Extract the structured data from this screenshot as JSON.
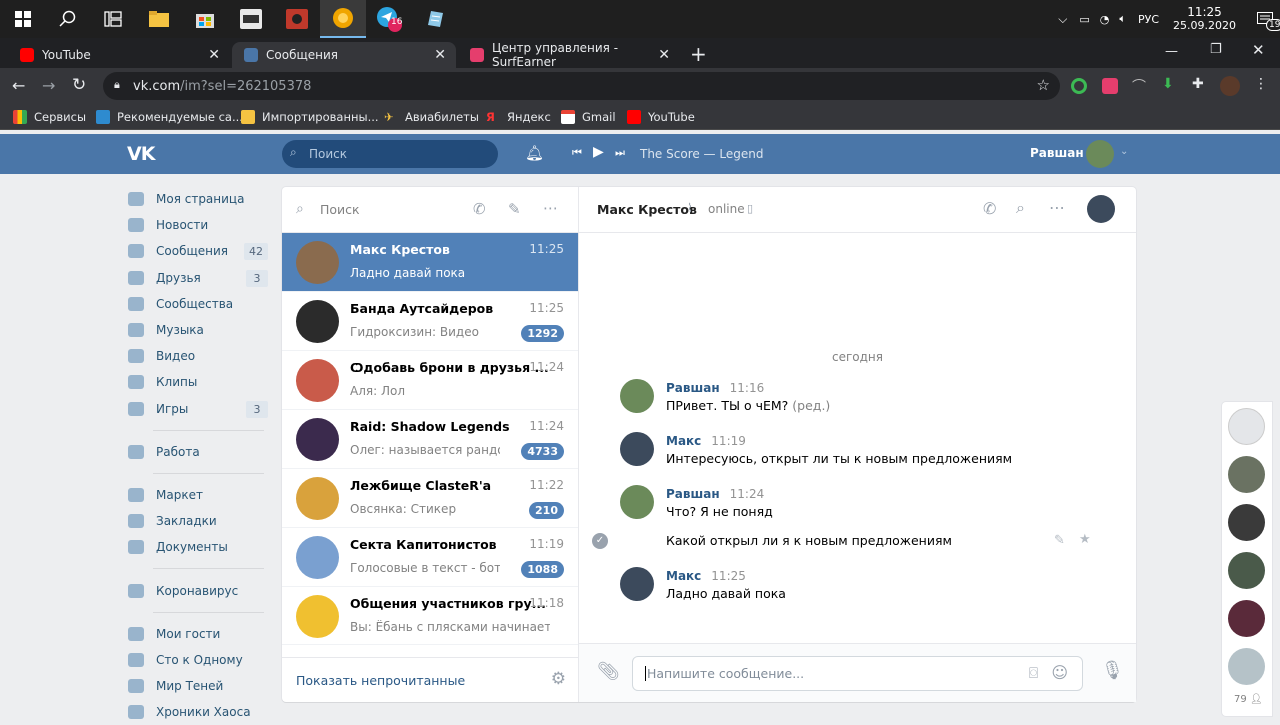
{
  "taskbar": {
    "clock_time": "11:25",
    "clock_date": "25.09.2020",
    "lang": "РУС",
    "notif_count": "19",
    "telegram_badge": "16"
  },
  "browser": {
    "tabs": [
      {
        "title": "YouTube",
        "fav_color": "#ff0000"
      },
      {
        "title": "Сообщения",
        "fav_color": "#4a76a8"
      },
      {
        "title": "Центр управления - SurfEarner",
        "fav_color": "#e53e6d"
      }
    ],
    "url_host": "vk.com",
    "url_path": "/im?sel=262105378",
    "bookmarks": [
      "Сервисы",
      "Рекомендуемые са...",
      "Импортированны...",
      "Авиабилеты",
      "Яндекс",
      "Gmail",
      "YouTube"
    ]
  },
  "vk": {
    "logo": "VK",
    "search_placeholder": "Поиск",
    "player_track": "The Score — Legend",
    "user_name": "Равшан"
  },
  "nav": {
    "items": [
      {
        "label": "Моя страница",
        "count": ""
      },
      {
        "label": "Новости",
        "count": ""
      },
      {
        "label": "Сообщения",
        "count": "42"
      },
      {
        "label": "Друзья",
        "count": "3"
      },
      {
        "label": "Сообщества",
        "count": ""
      },
      {
        "label": "Музыка",
        "count": ""
      },
      {
        "label": "Видео",
        "count": ""
      },
      {
        "label": "Клипы",
        "count": ""
      },
      {
        "label": "Игры",
        "count": "3"
      }
    ],
    "items2": [
      {
        "label": "Работа"
      }
    ],
    "items3": [
      {
        "label": "Маркет"
      },
      {
        "label": "Закладки"
      },
      {
        "label": "Документы"
      }
    ],
    "items4": [
      {
        "label": "Коронавирус"
      }
    ],
    "items5": [
      {
        "label": "Мои гости"
      },
      {
        "label": "Сто к Одному"
      },
      {
        "label": "Мир Теней"
      },
      {
        "label": "Хроники Хаоса"
      }
    ]
  },
  "conversations": {
    "search_placeholder": "Поиск",
    "items": [
      {
        "name": "Макс Крестов",
        "time": "11:25",
        "preview": "Ладно давай пока",
        "badge": "",
        "color": "#8a6b4e"
      },
      {
        "name": "Банда Аутсайдеров",
        "time": "11:25",
        "preview": "Гидроксизин: Видео",
        "badge": "1292",
        "color": "#2b2b2b"
      },
      {
        "name": "Ѻдобавь брони в друзья ...",
        "time": "11:24",
        "preview": "Аля: Лол",
        "badge": "",
        "color": "#c95b4a"
      },
      {
        "name": "Raid: Shadow Legends",
        "time": "11:24",
        "preview": "Олег: называется рандом...",
        "badge": "4733",
        "color": "#3b2a4d"
      },
      {
        "name": "Лежбище ClasteR'a",
        "time": "11:22",
        "preview": "Овсянка: Стикер",
        "badge": "210",
        "color": "#d9a23c"
      },
      {
        "name": "Секта Капитонистов",
        "time": "11:19",
        "preview": "Голосовые в текст - бот: [...",
        "badge": "1088",
        "color": "#7aa0d0"
      },
      {
        "name": "Общения участников гру...",
        "time": "11:18",
        "preview": "Вы: Ёбань с плясками начинается",
        "badge": "",
        "color": "#f0c030"
      }
    ],
    "footer_link": "Показать непрочитанные"
  },
  "chat": {
    "peer_name": "Макс Крестов",
    "peer_status": "online",
    "date_separator": "сегодня",
    "messages": [
      {
        "author": "Равшан",
        "time": "11:16",
        "text": "ПРивет. ТЫ о чЕМ?",
        "edited": "(ред.)"
      },
      {
        "author": "Макс",
        "time": "11:19",
        "text": "Интересуюсь, открыт ли ты к новым предложениям"
      },
      {
        "author": "Равшан",
        "time": "11:24",
        "text": "Что? Я не поняд",
        "extra": "Какой открыл ли я к новым предложениям"
      },
      {
        "author": "Макс",
        "time": "11:25",
        "text": "Ладно давай пока"
      }
    ],
    "composer_placeholder": "Напишите сообщение..."
  },
  "rightbar": {
    "online_count": "79"
  }
}
